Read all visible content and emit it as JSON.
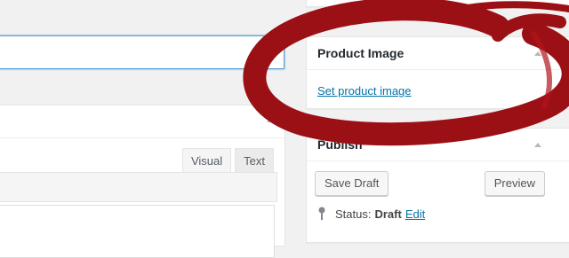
{
  "editor": {
    "title_value": "",
    "tabs": [
      {
        "label": "Visual",
        "active": true
      },
      {
        "label": "Text",
        "active": false
      }
    ]
  },
  "product_image": {
    "title": "Product Image",
    "link_label": "Set product image"
  },
  "publish": {
    "title": "Publish",
    "save_draft_label": "Save Draft",
    "preview_label": "Preview",
    "status_label": "Status:",
    "status_value": "Draft",
    "status_edit_label": "Edit"
  },
  "colors": {
    "accent_link": "#0073aa",
    "annotation_red": "#9b1015",
    "focus_border": "#5b9dd9"
  },
  "icons": {
    "collapse": "arrow-up-icon",
    "status": "pin-icon"
  }
}
